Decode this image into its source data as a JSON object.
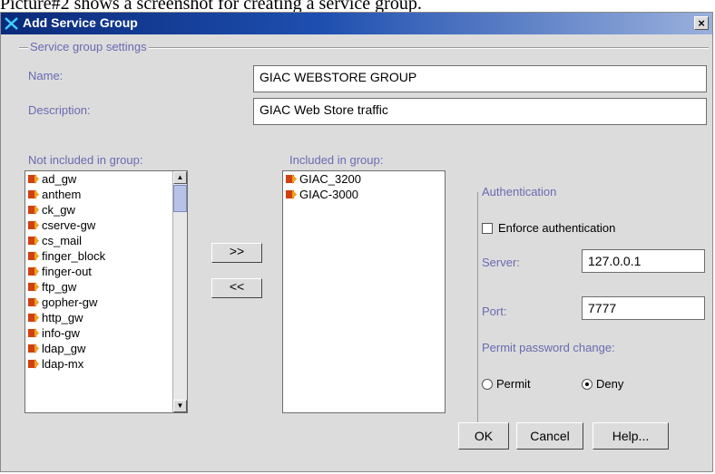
{
  "caption": "Picture#2 shows a screenshot for creating a service group.",
  "dialog": {
    "title": "Add Service Group",
    "close_label": "×"
  },
  "settings": {
    "legend": "Service group settings",
    "name_label": "Name:",
    "name_value": "GIAC WEBSTORE GROUP",
    "description_label": "Description:",
    "description_value": "GIAC Web Store traffic"
  },
  "lists": {
    "not_included_label": "Not included in group:",
    "not_included_items": [
      "ad_gw",
      "anthem",
      "ck_gw",
      "cserve-gw",
      "cs_mail",
      "finger_block",
      "finger-out",
      "ftp_gw",
      "gopher-gw",
      "http_gw",
      "info-gw",
      "ldap_gw",
      "ldap-mx"
    ],
    "included_label": "Included in group:",
    "included_items": [
      "GIAC_3200",
      "GIAC-3000"
    ],
    "add_label": ">>",
    "remove_label": "<<"
  },
  "auth": {
    "legend": "Authentication",
    "enforce_label": "Enforce authentication",
    "server_label": "Server:",
    "server_value": "127.0.0.1",
    "port_label": "Port:",
    "port_value": "7777",
    "password_label": "Permit password change:",
    "permit_label": "Permit",
    "deny_label": "Deny",
    "selected": "deny"
  },
  "buttons": {
    "ok": "OK",
    "cancel": "Cancel",
    "help": "Help..."
  }
}
